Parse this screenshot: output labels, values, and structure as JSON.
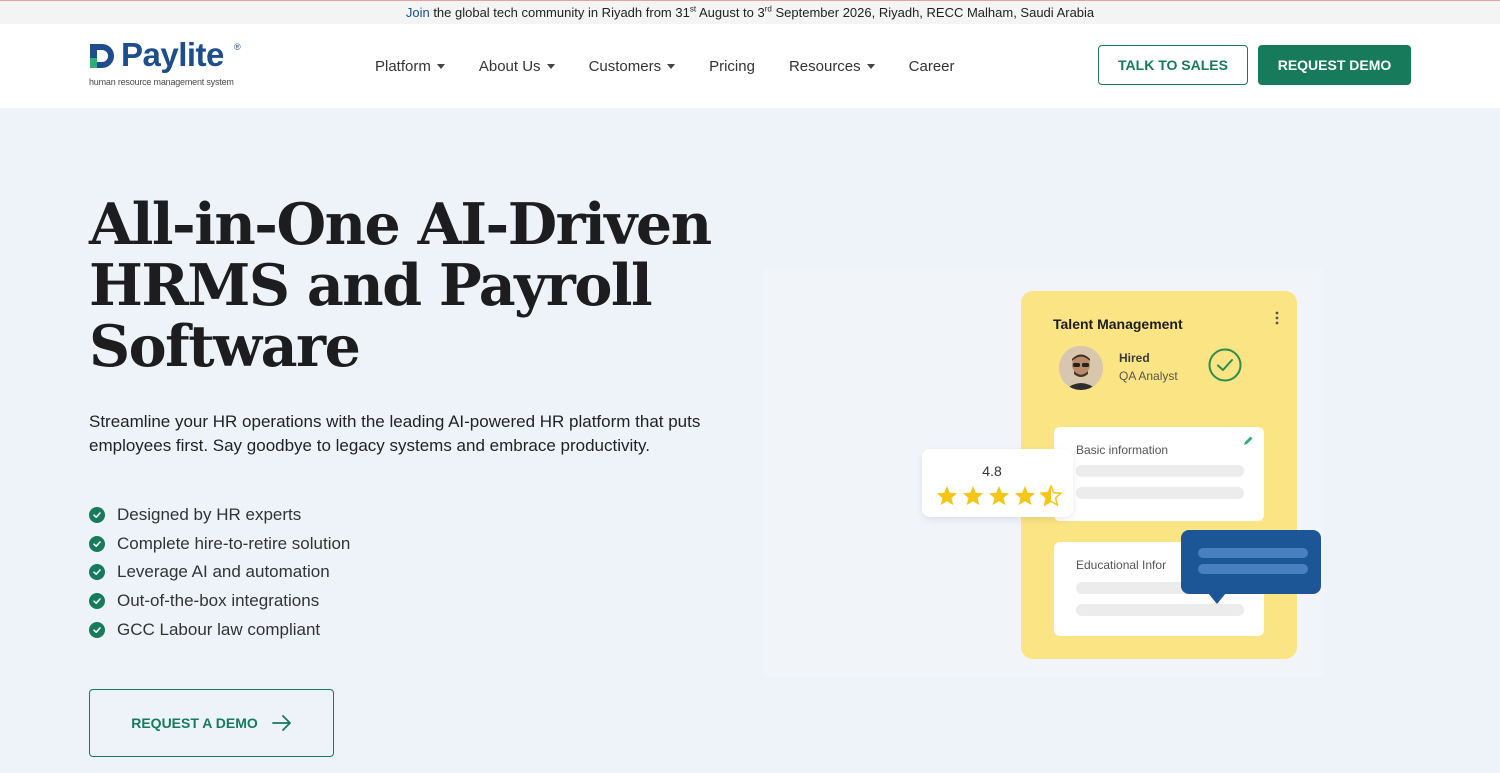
{
  "announcement": {
    "link": "Join",
    "part1": " the global tech community in Riyadh from 31",
    "sup1": "st",
    "part2": " August to 3",
    "sup2": "rd",
    "part3": " September 2026, Riyadh, RECC Malham, Saudi Arabia"
  },
  "brand": {
    "name": "Paylite",
    "reg": "®",
    "tagline": "human resource management system",
    "color": "#1e4d8c"
  },
  "nav": {
    "items": [
      {
        "label": "Platform",
        "dropdown": true
      },
      {
        "label": "About Us",
        "dropdown": true
      },
      {
        "label": "Customers",
        "dropdown": true
      },
      {
        "label": "Pricing",
        "dropdown": false
      },
      {
        "label": "Resources",
        "dropdown": true
      },
      {
        "label": "Career",
        "dropdown": false
      }
    ],
    "talk_to_sales": "TALK TO SALES",
    "request_demo": "REQUEST DEMO"
  },
  "hero": {
    "title_line1": "All-in-One AI-Driven",
    "title_line2": "HRMS and Payroll",
    "title_line3": "Software",
    "subtitle": "Streamline your HR operations with the leading AI-powered HR platform that puts employees first. Say goodbye to legacy systems and embrace productivity.",
    "features": [
      "Designed by HR experts",
      "Complete hire-to-retire solution",
      "Leverage AI and automation",
      "Out-of-the-box integrations",
      "GCC Labour law compliant"
    ],
    "cta": "REQUEST A DEMO"
  },
  "illustration": {
    "card_title": "Talent Management",
    "status": "Hired",
    "role": "QA Analyst",
    "section1": "Basic information",
    "section2": "Educational Infor",
    "rating": "4.8",
    "rating_stars": 4.5,
    "rating_max": 5
  },
  "colors": {
    "accent": "#177a5a",
    "card_yellow": "#fbe484",
    "chat_blue": "#1d5697",
    "star": "#f5c518",
    "background": "#eef3f9"
  }
}
